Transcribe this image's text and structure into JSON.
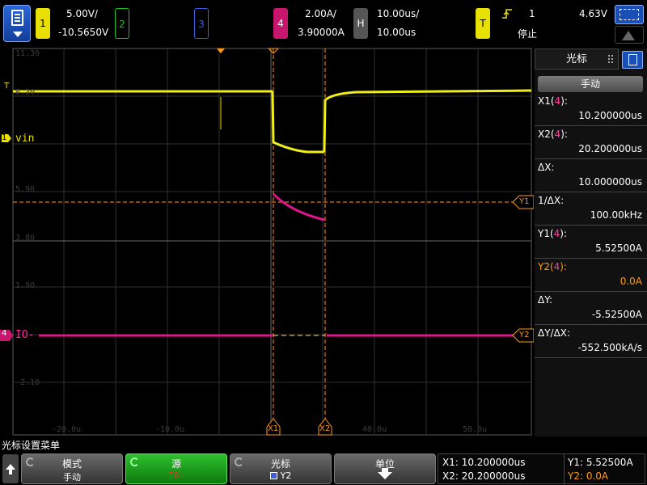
{
  "top": {
    "ch1": {
      "label": "1",
      "scale": "5.00V/",
      "offset": "-10.5650V",
      "color": "#e8e000"
    },
    "ch2": {
      "label": "2",
      "color": "#1cc41c"
    },
    "ch3": {
      "label": "3",
      "color": "#3a5fe0"
    },
    "ch4": {
      "label": "4",
      "scale": "2.00A/",
      "offset": "3.90000A",
      "color": "#c8156e"
    },
    "horizontal": {
      "label": "H",
      "scale": "10.00us/",
      "position": "10.00us"
    },
    "trigger": {
      "label": "T",
      "source": "1",
      "level": "4.63V",
      "status": "停止",
      "slope_icon": "rising-edge-icon"
    }
  },
  "scope": {
    "y_labels": [
      "11.30",
      "8.30",
      "5.90",
      "3.80",
      "1.90",
      "-2.10"
    ],
    "x_labels": [
      "-20.0u",
      "-10.0u",
      "40.0u",
      "50.0u"
    ],
    "ch1_label": "vin",
    "ch4_label": "IO-",
    "ch1_marker": "1",
    "ch4_marker": "4",
    "trig_marker": "T",
    "x1_tag": "X1",
    "x2_tag": "X2",
    "y1_tag": "Y1",
    "y2_tag": "Y2"
  },
  "panel": {
    "title": "光标",
    "mode": "手动",
    "rows": [
      {
        "label": "X1(4):",
        "value": "10.200000us"
      },
      {
        "label": "X2(4):",
        "value": "20.200000us"
      },
      {
        "label": "ΔX:",
        "value": "10.000000us"
      },
      {
        "label": "1/ΔX:",
        "value": "100.00kHz"
      },
      {
        "label": "Y1(4):",
        "value": "5.52500A"
      },
      {
        "label": "Y2(4):",
        "value": "0.0A"
      },
      {
        "label": "ΔY:",
        "value": "-5.52500A"
      },
      {
        "label": "ΔY/ΔX:",
        "value": "-552.500kA/s"
      }
    ]
  },
  "softkeys": {
    "menu_title": "光标设置菜单",
    "mode": {
      "label": "模式",
      "value": "手动"
    },
    "source": {
      "label": "源",
      "value": "IO-"
    },
    "cursor": {
      "label": "光标",
      "value": "Y2"
    },
    "units": {
      "label": "单位"
    }
  },
  "readout": {
    "x1": "X1: 10.200000us",
    "x2": "X2: 20.200000us",
    "y1": "Y1: 5.52500A",
    "y2": "Y2: 0.0A"
  }
}
